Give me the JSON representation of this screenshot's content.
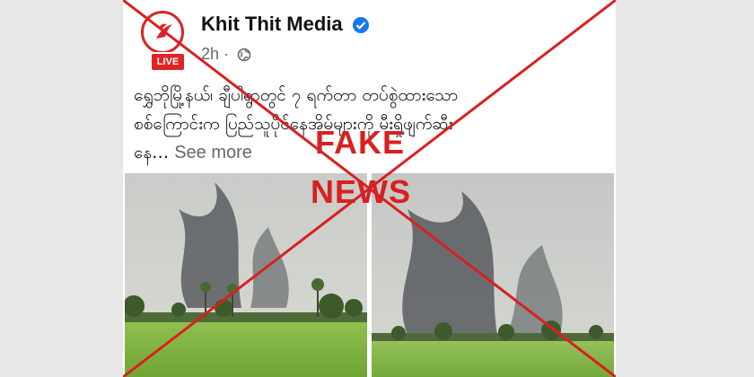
{
  "post": {
    "page_name": "Khit Thit Media",
    "verified_icon": "verified-badge-icon",
    "time": "2h",
    "separator": "·",
    "audience_icon": "globe-icon",
    "live_badge": "LIVE",
    "text_lines": [
      "ရွှေဘိုမြို့နယ်၊ ချီပါရွာတွင် ၇ ရက်တာ တပ်စွဲထားသော",
      "စစ်ကြောင်းက ပြည်သူပိုင်နေအိမ်များကို မီးရှို့ဖျက်ဆီး",
      "နေ…"
    ],
    "see_more": "See more"
  },
  "overlay": {
    "word_1": "FAKE",
    "word_2": "NEWS",
    "color": "#d92020"
  },
  "photos": [
    {
      "description_icon": "smoke-field-photo"
    },
    {
      "description_icon": "smoke-field-photo"
    }
  ]
}
